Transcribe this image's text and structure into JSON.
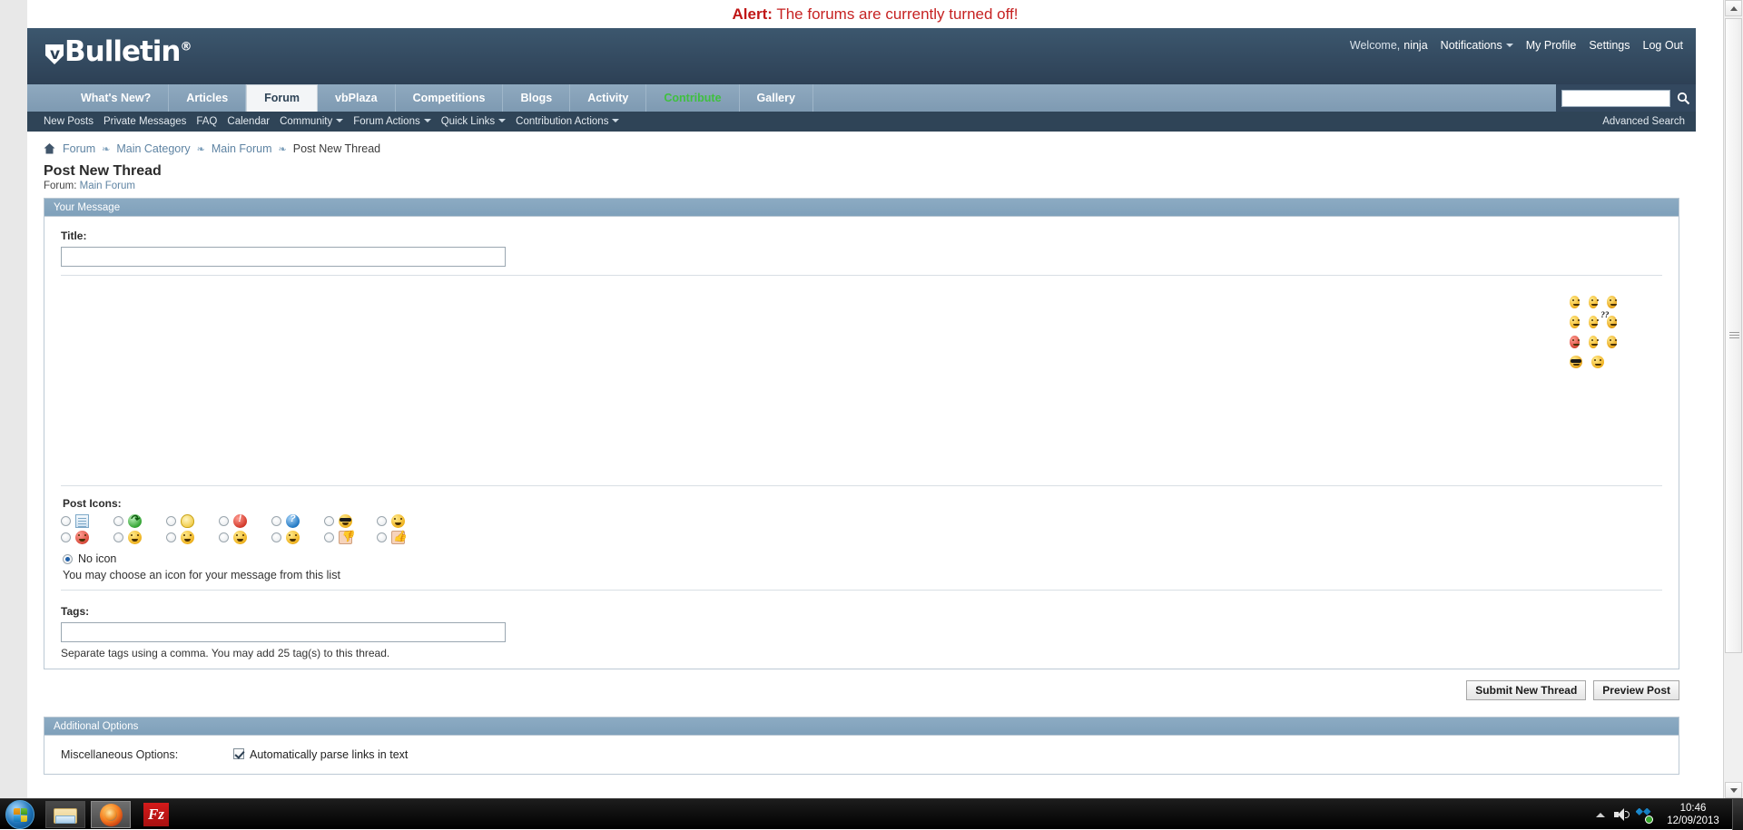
{
  "alert": {
    "label": "Alert:",
    "message": "The forums are currently turned off!"
  },
  "header": {
    "logo": "Bulletin",
    "logo_mark": "v",
    "logo_reg": "®",
    "welcome_prefix": "Welcome,",
    "username": "ninja",
    "links": [
      "Notifications",
      "My Profile",
      "Settings",
      "Log Out"
    ]
  },
  "nav": {
    "tabs": [
      {
        "label": "What's New?",
        "state": "normal"
      },
      {
        "label": "Articles",
        "state": "normal"
      },
      {
        "label": "Forum",
        "state": "active"
      },
      {
        "label": "vbPlaza",
        "state": "normal"
      },
      {
        "label": "Competitions",
        "state": "normal"
      },
      {
        "label": "Blogs",
        "state": "normal"
      },
      {
        "label": "Activity",
        "state": "normal"
      },
      {
        "label": "Contribute",
        "state": "green"
      },
      {
        "label": "Gallery",
        "state": "normal"
      }
    ],
    "search_value": "",
    "search_placeholder": "",
    "advanced_search": "Advanced Search",
    "sublinks": [
      {
        "label": "New Posts",
        "dropdown": false
      },
      {
        "label": "Private Messages",
        "dropdown": false
      },
      {
        "label": "FAQ",
        "dropdown": false
      },
      {
        "label": "Calendar",
        "dropdown": false
      },
      {
        "label": "Community",
        "dropdown": true
      },
      {
        "label": "Forum Actions",
        "dropdown": true
      },
      {
        "label": "Quick Links",
        "dropdown": true
      },
      {
        "label": "Contribution Actions",
        "dropdown": true
      }
    ]
  },
  "breadcrumb": {
    "items": [
      "Forum",
      "Main Category",
      "Main Forum",
      "Post New Thread"
    ],
    "separator": "❧"
  },
  "page": {
    "title": "Post New Thread",
    "forum_prefix": "Forum:",
    "forum_name": "Main Forum"
  },
  "message_panel": {
    "heading": "Your Message",
    "title_label": "Title:",
    "title_value": "",
    "post_icons_label": "Post Icons:",
    "post_icons": [
      {
        "name": "document-icon",
        "kind": "doc",
        "selected": false
      },
      {
        "name": "arrow-icon",
        "kind": "arrow",
        "selected": false
      },
      {
        "name": "lightbulb-icon",
        "kind": "bulb",
        "selected": false
      },
      {
        "name": "exclamation-icon",
        "kind": "excl",
        "selected": false
      },
      {
        "name": "question-icon",
        "kind": "quest",
        "selected": false
      },
      {
        "name": "cool-face-icon",
        "kind": "cool",
        "selected": false
      },
      {
        "name": "smile-face-icon",
        "kind": "smile",
        "selected": false
      },
      {
        "name": "angry-face-icon",
        "kind": "angry",
        "selected": false
      },
      {
        "name": "frown-face-icon",
        "kind": "frown",
        "selected": false
      },
      {
        "name": "grin-face-icon",
        "kind": "grin",
        "selected": false
      },
      {
        "name": "happy-face-icon",
        "kind": "happy",
        "selected": false
      },
      {
        "name": "wink-face-icon",
        "kind": "wink",
        "selected": false
      },
      {
        "name": "thumbs-down-icon",
        "kind": "thumbdown",
        "selected": false
      },
      {
        "name": "thumbs-up-icon",
        "kind": "thumbup",
        "selected": false
      }
    ],
    "no_icon_label": "No icon",
    "no_icon_selected": true,
    "icon_hint": "You may choose an icon for your message from this list",
    "tags_label": "Tags:",
    "tags_value": "",
    "tags_hint": "Separate tags using a comma. You may add 25 tag(s) to this thread.",
    "smilies": [
      [
        {
          "name": "smilie-grin",
          "style": "y",
          "face": "grin"
        },
        {
          "name": "smilie-biggrin",
          "style": "y",
          "face": "biggrin"
        },
        {
          "name": "smilie-smile",
          "style": "k",
          "face": "smile"
        }
      ],
      [
        {
          "name": "smilie-wink",
          "style": "y",
          "face": "wink"
        },
        {
          "name": "smilie-confused",
          "style": "y",
          "face": "confused"
        },
        {
          "name": "smilie-question",
          "style": "k",
          "face": "question"
        }
      ],
      [
        {
          "name": "smilie-mad",
          "style": "r",
          "face": "mad"
        },
        {
          "name": "smilie-tongue",
          "style": "y",
          "face": "tongue"
        },
        {
          "name": "smilie-happy",
          "style": "k",
          "face": "happy"
        }
      ],
      [
        {
          "name": "smilie-cool",
          "style": "k",
          "face": "cool"
        },
        {
          "name": "smilie-neutral",
          "style": "y",
          "face": "neutral"
        }
      ]
    ]
  },
  "buttons": {
    "submit": "Submit New Thread",
    "preview": "Preview Post"
  },
  "additional_options": {
    "heading": "Additional Options",
    "misc_label": "Miscellaneous Options:",
    "parse_links_label": "Automatically parse links in text",
    "parse_links_checked": true
  },
  "taskbar": {
    "start": "start-orb",
    "items": [
      {
        "name": "explorer",
        "label": "Windows Explorer"
      },
      {
        "name": "firefox",
        "label": "Mozilla Firefox"
      },
      {
        "name": "filezilla",
        "label": "FileZilla"
      }
    ],
    "tray": {
      "volume": "volume-icon",
      "dropbox": "dropbox-icon",
      "time": "10:46",
      "date": "12/09/2013"
    }
  },
  "colors": {
    "alert_red": "#c62222",
    "header_blue": "#33485f",
    "tabbar_blue": "#86a1b8",
    "panel_head": "#86a5bd",
    "link_blue": "#5f84a3",
    "green_tab": "#3fc03f"
  }
}
